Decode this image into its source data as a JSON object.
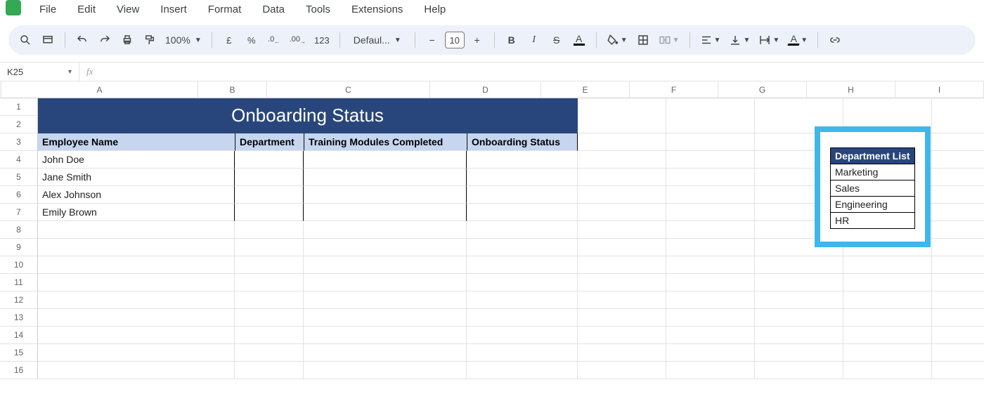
{
  "menus": [
    "File",
    "Edit",
    "View",
    "Insert",
    "Format",
    "Data",
    "Tools",
    "Extensions",
    "Help"
  ],
  "toolbar": {
    "zoom": "100%",
    "currency": "£",
    "percent": "%",
    "dec_less": ".0",
    "dec_more": ".00",
    "numfmt": "123",
    "font": "Defaul...",
    "font_size": "10",
    "bold": "B",
    "italic": "I",
    "strike": "S",
    "textcolor_letter": "A",
    "hl_letter": "A"
  },
  "name_box": "K25",
  "fx_label": "fx",
  "columns": [
    "A",
    "B",
    "C",
    "D",
    "E",
    "F",
    "G",
    "H",
    "I"
  ],
  "row_numbers": [
    "1",
    "2",
    "3",
    "4",
    "5",
    "6",
    "7",
    "8",
    "9",
    "10",
    "11",
    "12",
    "13",
    "14",
    "15",
    "16"
  ],
  "title": "Onboarding Status",
  "headers": {
    "a": "Employee Name",
    "b": "Department",
    "c": "Training Modules Completed",
    "d": "Onboarding Status"
  },
  "employees": [
    "John Doe",
    "Jane Smith",
    "Alex Johnson",
    "Emily Brown"
  ],
  "dept_list_header": "Department List",
  "departments": [
    "Marketing",
    "Sales",
    "Engineering",
    "HR"
  ]
}
